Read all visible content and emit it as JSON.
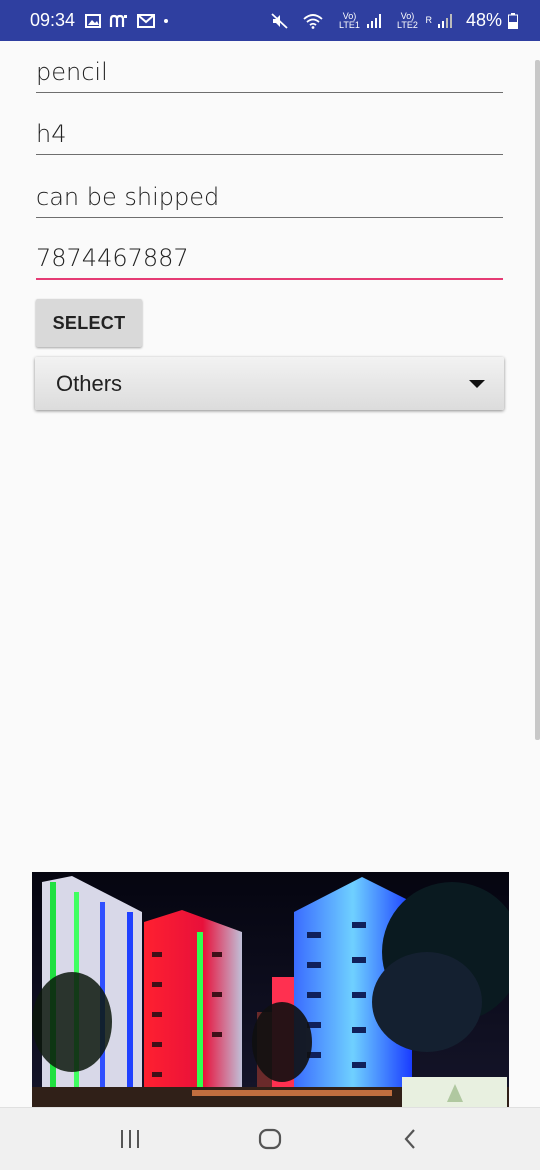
{
  "status_bar": {
    "time": "09:34",
    "notification_icons": [
      "gallery-icon",
      "app-notification-icon",
      "gmail-icon",
      "dot-icon"
    ],
    "sim1_label": "Vo) LTE1",
    "sim2_label": "Vo) LTE2",
    "roaming": "R",
    "battery": "48%"
  },
  "form": {
    "item_name": "pencil",
    "code": "h4",
    "shipping": "can be shipped",
    "phone": "7874467887",
    "select_label": "SELECT",
    "category": "Others"
  },
  "colors": {
    "status_bar": "#2f3fa0",
    "focus_underline": "#e53b74",
    "background": "#fafafa"
  },
  "nav_bar": {
    "icons": [
      "recent-apps-icon",
      "home-icon",
      "back-icon"
    ]
  }
}
